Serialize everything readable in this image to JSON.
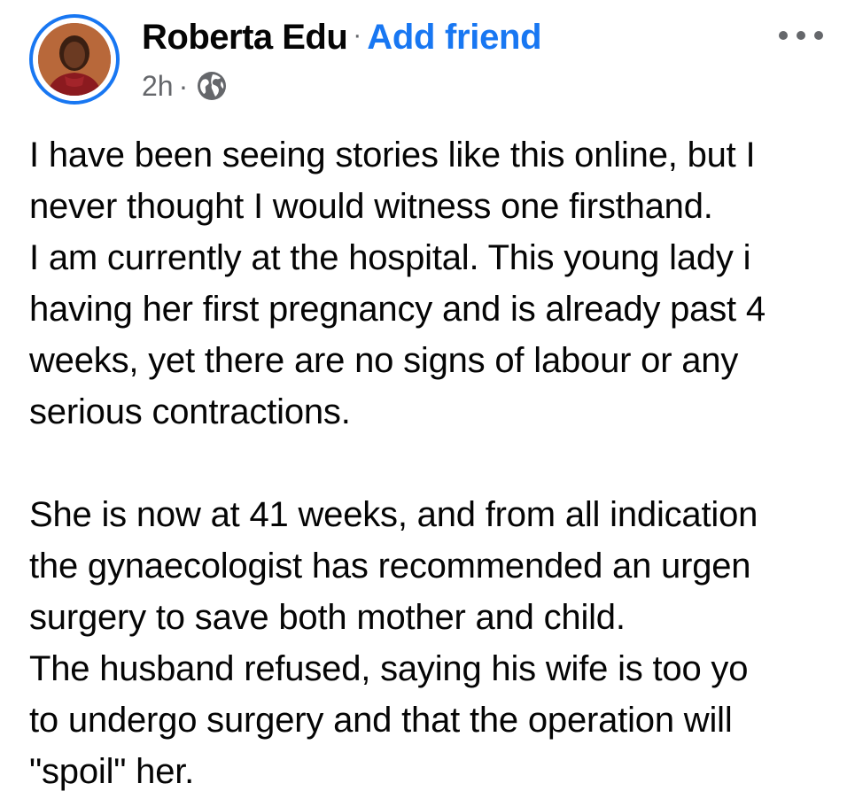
{
  "post": {
    "author": {
      "name": "Roberta Edu",
      "separator": "·",
      "add_friend_label": "Add friend"
    },
    "meta": {
      "time": "2h",
      "separator": "·",
      "audience_icon": "globe-icon"
    },
    "more_icon": "more-horizontal-icon",
    "body_lines": [
      "I have been seeing stories like this online, but I",
      "never thought I would witness one firsthand.",
      "I am currently at the hospital. This young lady i",
      "having her first pregnancy and is already past 4",
      "weeks, yet there are no signs of labour or any",
      "serious contractions.",
      "",
      "She is now at 41 weeks, and from all indication",
      "the gynaecologist has recommended an urgen",
      "surgery to save both mother and child.",
      "The husband refused, saying his wife is too yo",
      "to undergo surgery and that the operation will",
      "\"spoil\" her."
    ]
  },
  "colors": {
    "accent": "#1877f2",
    "text": "#050505",
    "secondary_text": "#65676b",
    "background": "#ffffff"
  }
}
